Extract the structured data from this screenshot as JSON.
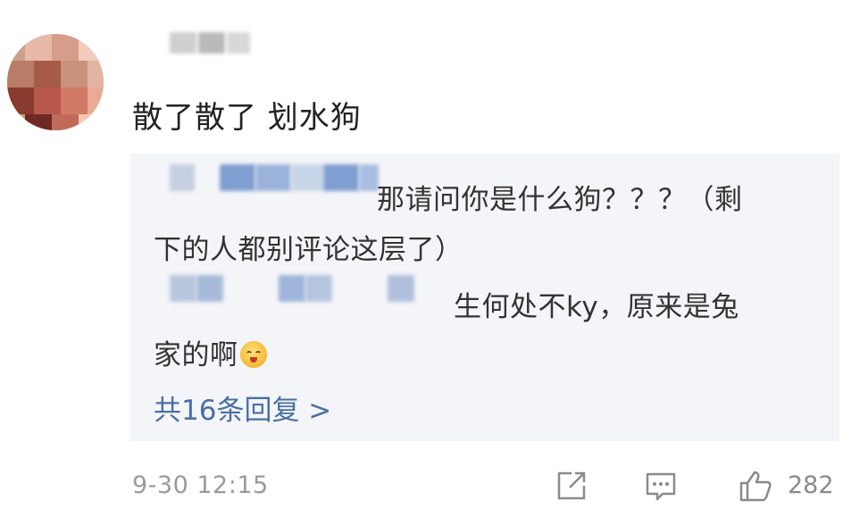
{
  "comment": {
    "text": "散了散了 划水狗",
    "timestamp": "9-30 12:15",
    "like_count": "282"
  },
  "replies": {
    "lines": [
      "那请问你是什么狗？？？（剩",
      "下的人都别评论这层了）",
      "生何处不ky，原来是兔",
      "家的啊"
    ],
    "emoji": "smiling-face-emoji",
    "more_label": "共16条回复 >"
  },
  "icons": {
    "share": "share-icon",
    "comment": "comment-icon",
    "like": "thumbs-up-icon"
  },
  "colors": {
    "link": "#4a6fa5",
    "reply_background": "#f4f5f8",
    "muted_text": "#9a9a9a"
  }
}
